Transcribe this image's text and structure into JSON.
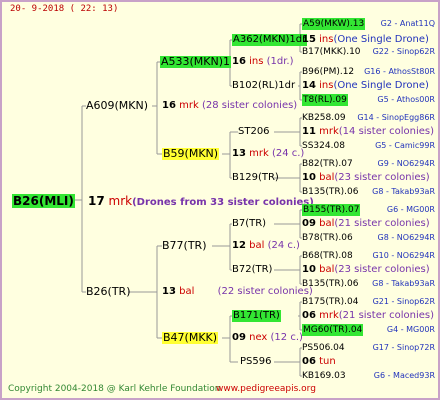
{
  "date": "20-  9-2018 (  22:  13)",
  "footer": {
    "copyright": "Copyright 2004-2018 @ Karl Kehrle Foundation",
    "url": "www.pedigreeapis.org"
  },
  "root": {
    "name": "B26(MLI)",
    "num": "17",
    "abbr": "mrk",
    "note": "(Drones from 33 sister colonies)"
  },
  "sire": {
    "name": "A609(MKN)",
    "num": "16",
    "abbr": "mrk",
    "note": "(28 sister colonies)"
  },
  "dam": {
    "name": "B26(TR)",
    "num": "13",
    "abbr": "bal",
    "note": "(22 sister colonies)"
  },
  "ss": {
    "name": "A533(MKN)1",
    "num": "16",
    "abbr": "ins",
    "note": "(1dr.)"
  },
  "sd": {
    "name": "B59(MKN)",
    "num": "13",
    "abbr": "mrk",
    "note": "(24 c.)"
  },
  "ds": {
    "name": "B77(TR)",
    "num": "12",
    "abbr": "bal",
    "note": "(24 c.)"
  },
  "dd": {
    "name": "B47(MKK)",
    "num": "09",
    "abbr": "nex",
    "note": "(12 c.)"
  },
  "sss": {
    "name": "A362(MKN)1dr",
    "num": "15",
    "abbr": "ins",
    "note": "(One Single Drone)"
  },
  "ssd": {
    "name": "B102(RL)1dr",
    "num": "14",
    "abbr": "ins",
    "note": "(One Single Drone)"
  },
  "sds": {
    "name": "ST206",
    "num": "11",
    "abbr": "mrk",
    "note": "(14 sister colonies)"
  },
  "sdd": {
    "name": "B129(TR)",
    "num": "10",
    "abbr": "bal",
    "note": "(23 sister colonies)"
  },
  "dss": {
    "name": "B7(TR)",
    "num": "09",
    "abbr": "bal",
    "note": "(21 sister colonies)"
  },
  "dsd": {
    "name": "B72(TR)",
    "num": "10",
    "abbr": "bal",
    "note": "(23 sister colonies)"
  },
  "dds": {
    "name": "B171(TR)",
    "num": "06",
    "abbr": "mrk",
    "note": "(21 sister colonies)"
  },
  "ddd": {
    "name": "PS596",
    "num": "06",
    "abbr": "tun",
    "note": ""
  },
  "g4": [
    {
      "name": "A59(MKW).13",
      "code": "G2 - Anat11Q"
    },
    {
      "name": "B17(MKK).10",
      "code": "G22 - Sinop62R"
    },
    {
      "name": "B96(PM).12",
      "code": "G16 - AthosSt80R"
    },
    {
      "name": "T8(RL).09",
      "code": "G5 - Athos00R"
    },
    {
      "name": "KB258.09",
      "code": "G14 - SinopEgg86R"
    },
    {
      "name": "SS324.08",
      "code": "G5 - Camic99R"
    },
    {
      "name": "B82(TR).07",
      "code": "G9 - NO6294R"
    },
    {
      "name": "B135(TR).06",
      "code": "G8 - Takab93aR"
    },
    {
      "name": "B155(TR).07",
      "code": "G6 - MG00R"
    },
    {
      "name": "B78(TR).06",
      "code": "G8 - NO6294R"
    },
    {
      "name": "B68(TR).08",
      "code": "G10 - NO6294R"
    },
    {
      "name": "B135(TR).06",
      "code": "G8 - Takab93aR"
    },
    {
      "name": "B175(TR).04",
      "code": "G21 - Sinop62R"
    },
    {
      "name": "MG60(TR).04",
      "code": "G4 - MG00R"
    },
    {
      "name": "PS506.04",
      "code": "G17 - Sinop72R"
    },
    {
      "name": "KB169.03",
      "code": "G6 - Maced93R"
    }
  ]
}
